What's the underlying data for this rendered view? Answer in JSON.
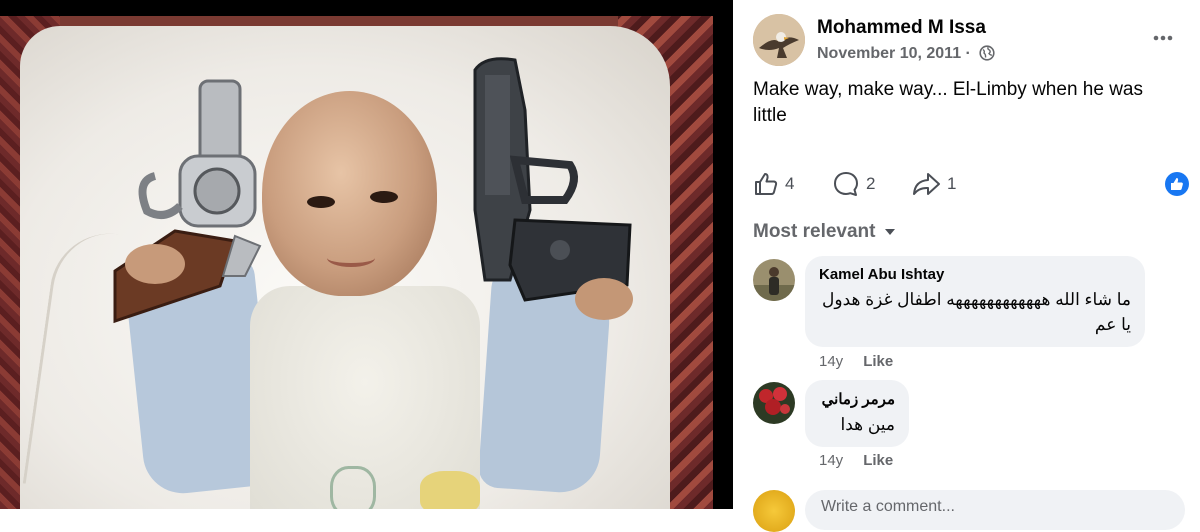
{
  "post": {
    "author": "Mohammed M Issa",
    "date": "November 10, 2011",
    "separator": "·",
    "privacy_icon": "globe-icon",
    "text": "Make way, make way... El-Limby when he was little",
    "more_icon": "more-horizontal-icon"
  },
  "stats": {
    "likes": "4",
    "comments": "2",
    "shares": "1",
    "like_icon": "thumbs-up-icon",
    "comment_icon": "comment-bubble-icon",
    "share_icon": "share-arrow-icon",
    "reaction_badge_icon": "like-reaction-icon"
  },
  "comments_header": {
    "sort_label": "Most relevant",
    "sort_icon": "caret-down-icon"
  },
  "comments": [
    {
      "name": "Kamel Abu Ishtay",
      "text": "ما شاء الله ههههههههههههه اطفال غزة هدول يا عم",
      "age": "14y",
      "like_label": "Like"
    },
    {
      "name": "مرمر زماني",
      "text": "مين هدا",
      "age": "14y",
      "like_label": "Like"
    }
  ],
  "composer": {
    "placeholder": "Write a comment..."
  },
  "colors": {
    "accent": "#1877f2",
    "text_primary": "#050505",
    "text_secondary": "#65676b",
    "bubble_bg": "#f0f2f5"
  }
}
